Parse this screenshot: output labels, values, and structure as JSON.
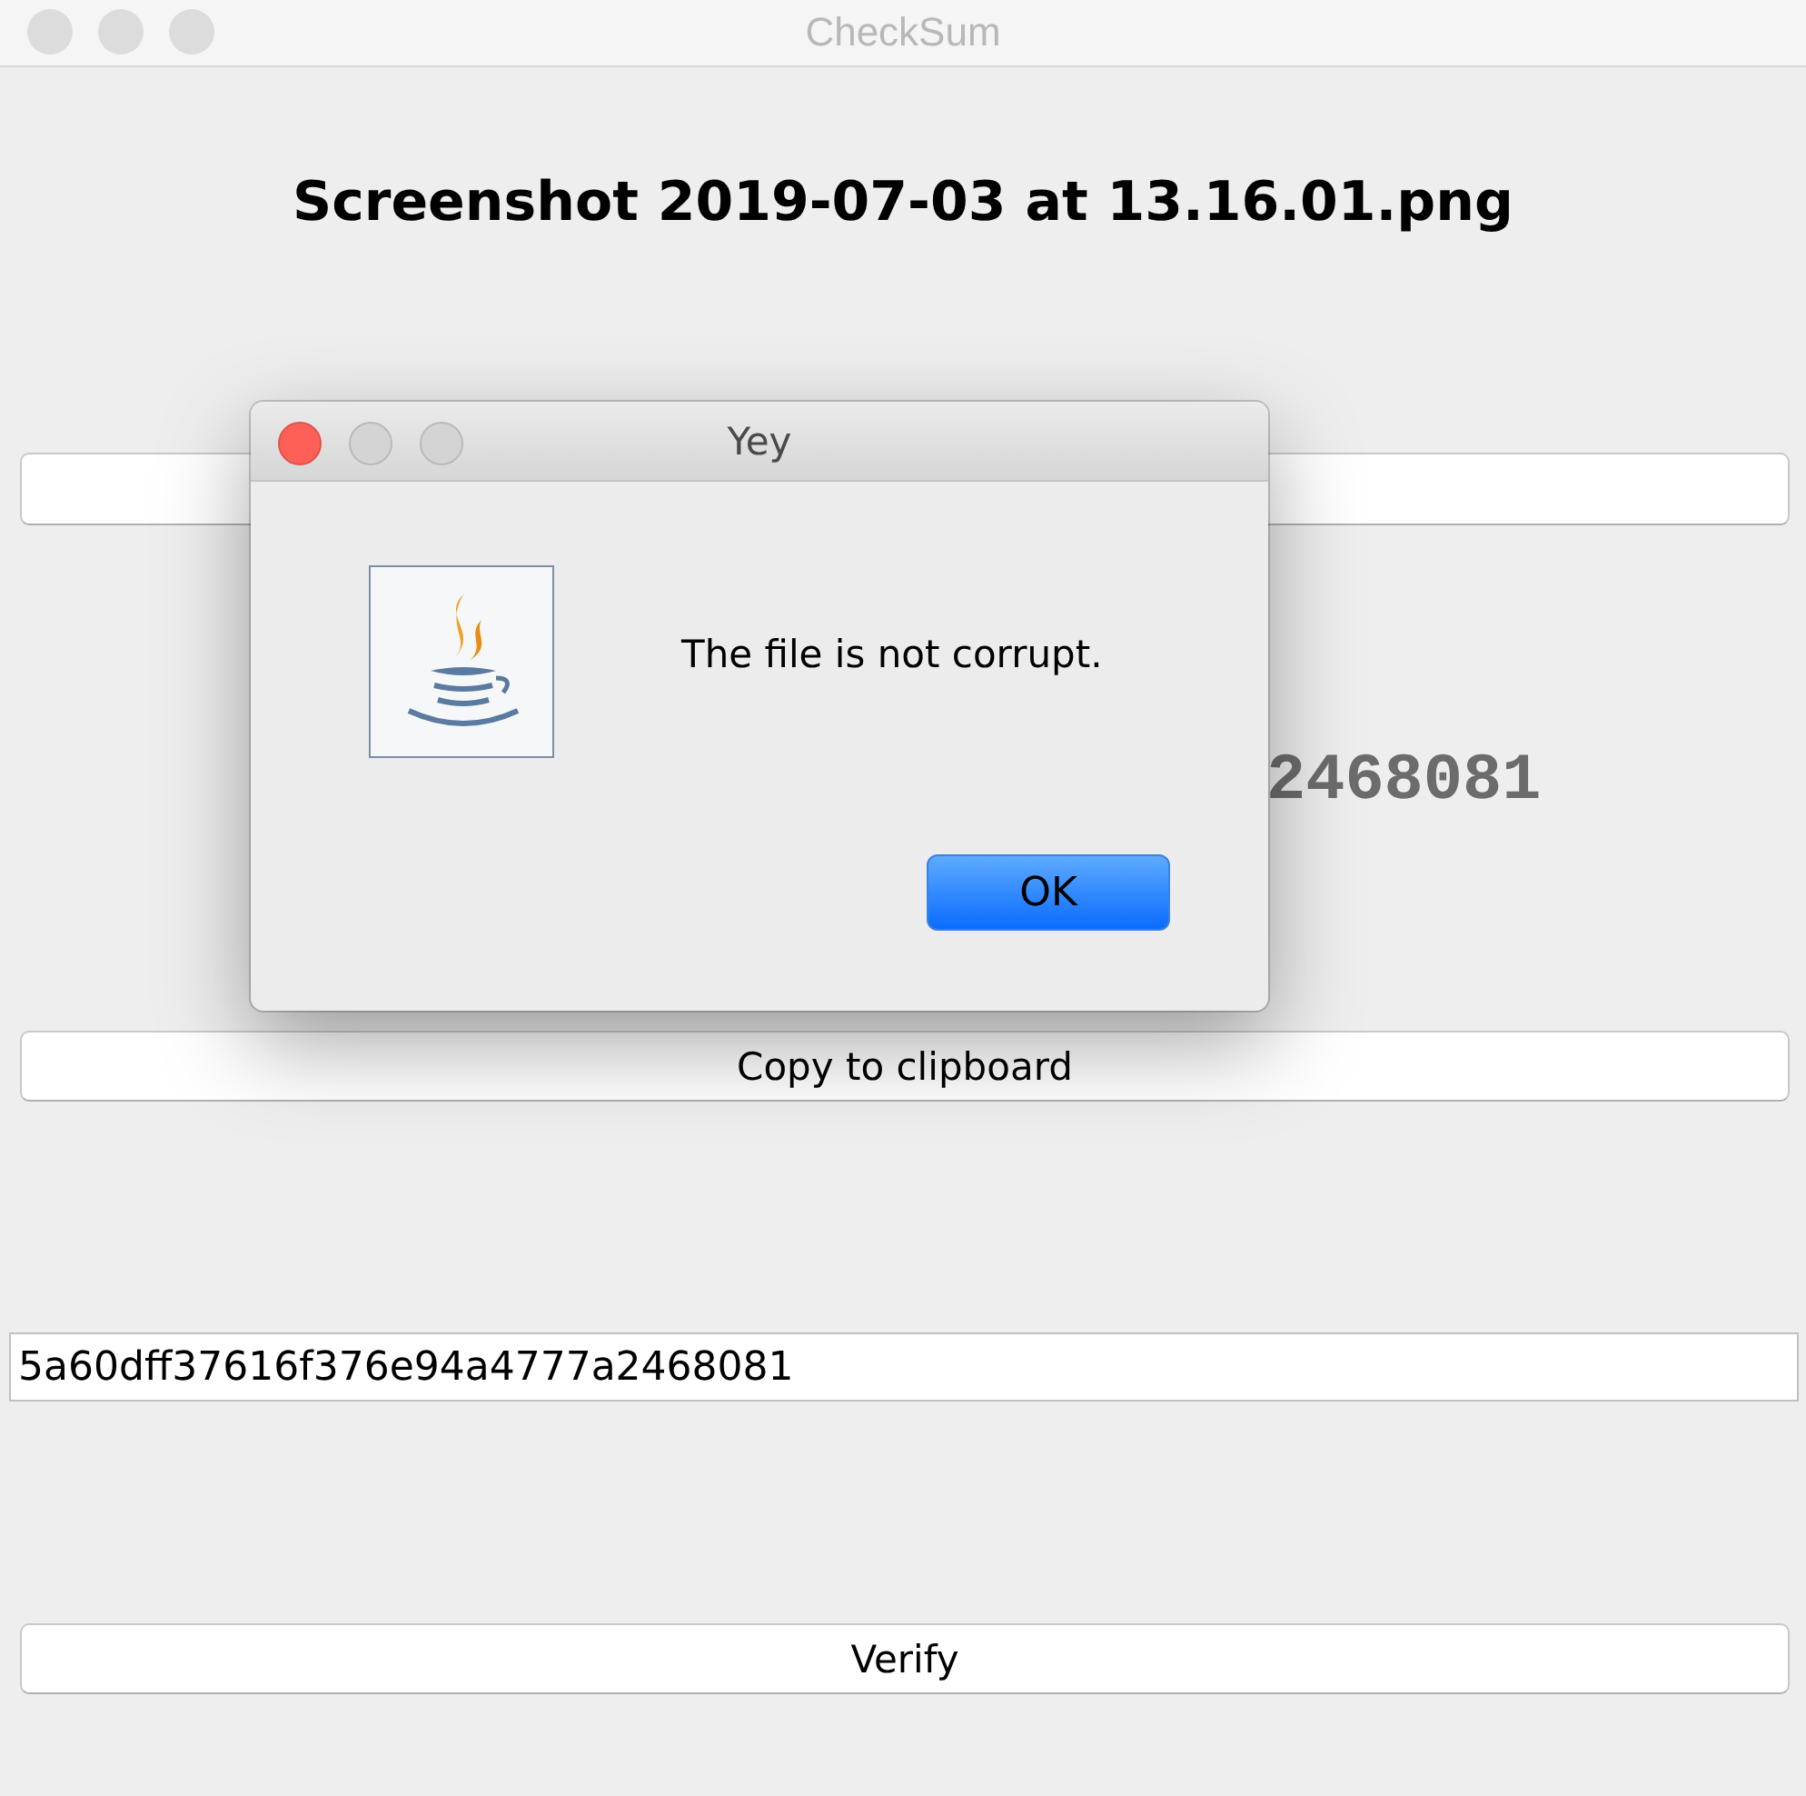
{
  "window": {
    "title": "CheckSum"
  },
  "file_name": "Screenshot 2019-07-03 at 13.16.01.png",
  "controls": [
    {
      "kind": "button"
    },
    {
      "kind": "hash",
      "text": "2468081"
    },
    {
      "kind": "button",
      "label": "Copy to clipboard"
    },
    {
      "kind": "field",
      "value": "5a60dff37616f376e94a4777a2468081"
    },
    {
      "kind": "button",
      "label": "Verify"
    }
  ],
  "dialog": {
    "title": "Yey",
    "message": "The file is not corrupt.",
    "buttons": [
      {
        "label": "OK",
        "default": true
      }
    ]
  }
}
